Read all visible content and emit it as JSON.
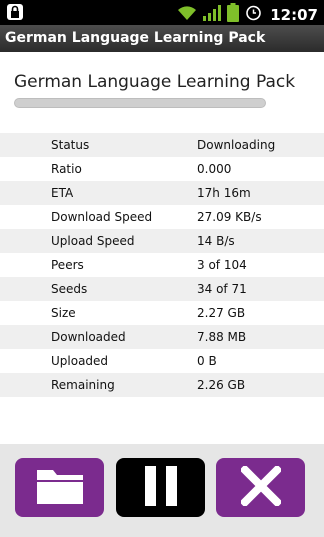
{
  "status_bar": {
    "time": "12:07",
    "icons": [
      "lock-icon",
      "wifi-icon",
      "signal-icon",
      "battery-icon",
      "alarm-icon"
    ]
  },
  "app": {
    "title": "German Language Learning Pack"
  },
  "torrent": {
    "name": "German Language Learning Pack",
    "progress": 0.0,
    "stats": [
      {
        "label": "Status",
        "value": "Downloading"
      },
      {
        "label": "Ratio",
        "value": "0.000"
      },
      {
        "label": "ETA",
        "value": "17h 16m"
      },
      {
        "label": "Download Speed",
        "value": "27.09 KB/s"
      },
      {
        "label": "Upload Speed",
        "value": "14 B/s"
      },
      {
        "label": "Peers",
        "value": "3 of 104"
      },
      {
        "label": "Seeds",
        "value": "34 of 71"
      },
      {
        "label": "Size",
        "value": "2.27 GB"
      },
      {
        "label": "Downloaded",
        "value": "7.88 MB"
      },
      {
        "label": "Uploaded",
        "value": "0 B"
      },
      {
        "label": "Remaining",
        "value": "2.26 GB"
      }
    ]
  },
  "actions": {
    "open_folder_icon": "folder-icon",
    "pause_icon": "pause-icon",
    "cancel_icon": "close-icon"
  },
  "colors": {
    "accent": "#7b2b8e",
    "pause_button": "#000000"
  }
}
